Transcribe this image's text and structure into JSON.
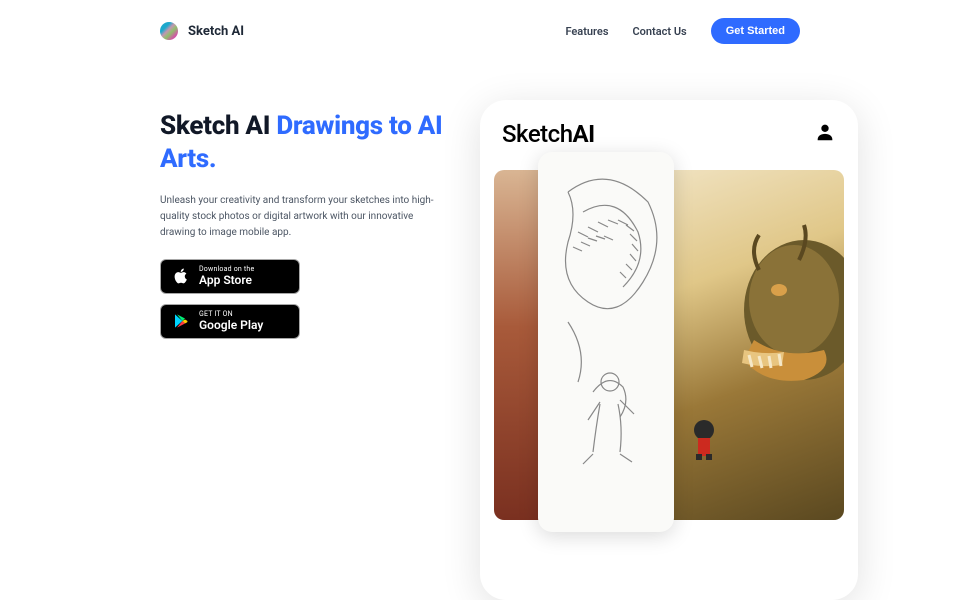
{
  "brand": {
    "name": "Sketch AI"
  },
  "nav": {
    "features": "Features",
    "contact": "Contact Us",
    "cta": "Get Started"
  },
  "hero": {
    "title_plain": "Sketch AI ",
    "title_accent": "Drawings to AI Arts.",
    "desc": "Unleash your creativity and transform your sketches into high-quality stock photos or digital artwork with our innovative drawing to image mobile app."
  },
  "badges": {
    "appstore": {
      "sup": "Download on the",
      "store": "App Store"
    },
    "play": {
      "sup": "GET IT ON",
      "store": "Google Play"
    }
  },
  "phone": {
    "title_a": "Sketch",
    "title_b": "AI"
  }
}
